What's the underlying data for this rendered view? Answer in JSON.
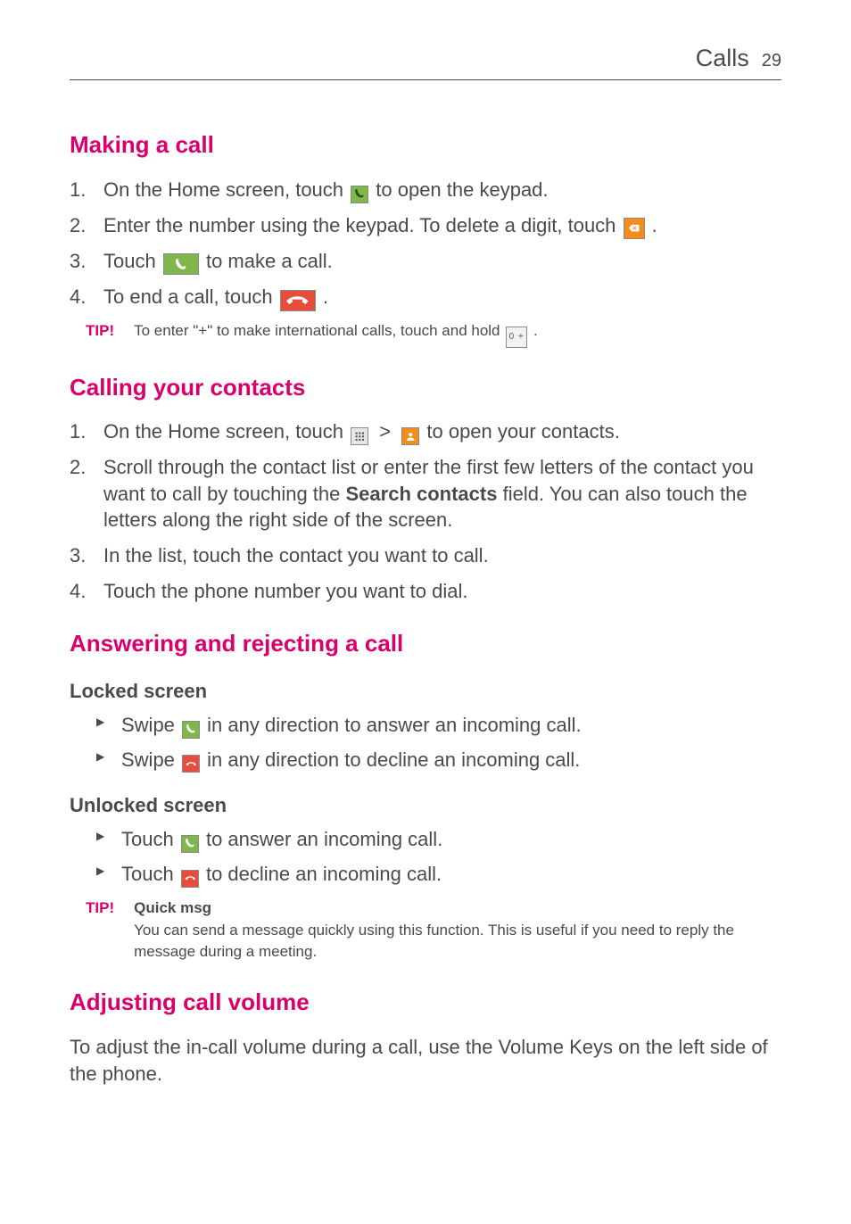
{
  "header": {
    "section": "Calls",
    "page": "29"
  },
  "s1": {
    "heading": "Making a call",
    "li1a": "On the Home screen, touch ",
    "li1b": " to open the keypad.",
    "li2a": "Enter the number using the keypad. To delete a digit, touch ",
    "li2b": ".",
    "li3a": "Touch ",
    "li3b": " to make a call.",
    "li4a": "To end a call, touch ",
    "li4b": ".",
    "tip_label": "TIP!",
    "tip_a": "To enter \"+\" to make international calls, touch and hold ",
    "tip_key": "0 +",
    "tip_b": "."
  },
  "s2": {
    "heading": "Calling your contacts",
    "li1a": "On the Home screen, touch ",
    "li1b": " to open your contacts.",
    "li2a": "Scroll through the contact list or enter the first few letters of the contact you want to call by touching the ",
    "li2bold": "Search contacts",
    "li2b": " field. You can also touch the letters along the right side of the screen.",
    "li3": "In the list, touch the contact you want to call.",
    "li4": "Touch the phone number you want to dial."
  },
  "s3": {
    "heading": "Answering and rejecting a call",
    "sub1": "Locked screen",
    "s1_b1a": "Swipe ",
    "s1_b1b": " in any direction to answer an incoming call.",
    "s1_b2a": "Swipe ",
    "s1_b2b": " in any direction to decline an incoming call.",
    "sub2": "Unlocked screen",
    "s2_b1a": "Touch ",
    "s2_b1b": " to answer an incoming call.",
    "s2_b2a": "Touch ",
    "s2_b2b": " to decline an incoming call.",
    "tip_label": "TIP!",
    "tip_title": "Quick msg",
    "tip_body": "You can send a message quickly using this function. This is useful if you need to reply the message during a meeting."
  },
  "s4": {
    "heading": "Adjusting call volume",
    "body": "To adjust the in-call volume during a call, use the Volume Keys on the left side of the phone."
  },
  "markers": {
    "n1": "1.",
    "n2": "2.",
    "n3": "3.",
    "n4": "4."
  },
  "icons": {
    "phone_green": "phone-icon",
    "backspace_orange": "backspace-icon",
    "call_green_wide": "call-icon",
    "endcall_red_wide": "end-call-icon",
    "key_zero": "zero-key-icon",
    "apps_grid": "apps-grid-icon",
    "contacts_orange": "contacts-icon",
    "answer_green": "answer-icon",
    "decline_red": "decline-icon"
  }
}
